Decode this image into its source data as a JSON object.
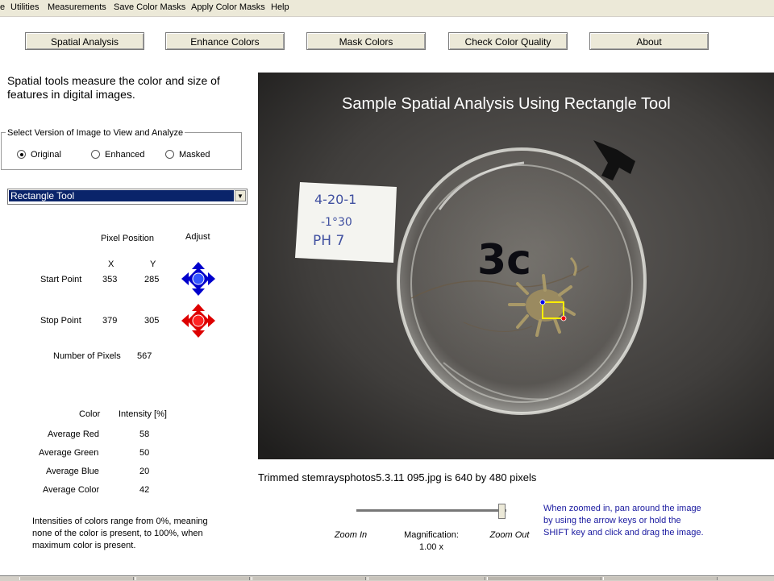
{
  "menu": [
    "e",
    "Utilities",
    "Measurements",
    "Save Color Masks",
    "Apply Color Masks",
    "Help"
  ],
  "tabs": [
    "Spatial Analysis",
    "Enhance Colors",
    "Mask Colors",
    "Check Color Quality",
    "About"
  ],
  "intro": "Spatial tools measure the color and size of features in digital images.",
  "version": {
    "legend": "Select Version of Image to View and Analyze",
    "options": [
      "Original",
      "Enhanced",
      "Masked"
    ],
    "selected": "Original"
  },
  "tool": {
    "selected": "Rectangle Tool"
  },
  "position": {
    "header": "Pixel Position",
    "adjust": "Adjust",
    "x_label": "X",
    "y_label": "Y",
    "start_label": "Start Point",
    "start_x": "353",
    "start_y": "285",
    "stop_label": "Stop Point",
    "stop_x": "379",
    "stop_y": "305",
    "pixels_label": "Number of Pixels",
    "pixels_value": "567"
  },
  "colors": {
    "col_header": "Color",
    "intensity_header": "Intensity [%]",
    "rows": [
      {
        "label": "Average Red",
        "value": "58"
      },
      {
        "label": "Average Green",
        "value": "50"
      },
      {
        "label": "Average Blue",
        "value": "20"
      },
      {
        "label": "Average Color",
        "value": "42"
      }
    ]
  },
  "note": "Intensities of colors range from 0%, meaning none of the color is present, to 100%, when maximum color is present.",
  "photo": {
    "title": "Sample Spatial Analysis Using Rectangle Tool",
    "label_lines": [
      "4-20-1",
      "-1°30",
      "PH 7"
    ],
    "dish_mark": "3c"
  },
  "caption": "Trimmed stemraysphotos5.3.11 095.jpg is 640 by 480 pixels",
  "zoom": {
    "zoom_in": "Zoom In",
    "zoom_out": "Zoom Out",
    "mag_label": "Magnification:",
    "mag_value": "1.00 x",
    "slider_level": 1.0,
    "help": "When zoomed in, pan around the image by using the arrow keys or hold the SHIFT key and click and drag the image."
  },
  "icons": {
    "start_adjust": "blue-direction-pad-icon",
    "stop_adjust": "red-direction-pad-icon"
  },
  "accent_colors": {
    "start": "#0000cc",
    "stop": "#dd0000",
    "selection": "#0a246a"
  }
}
